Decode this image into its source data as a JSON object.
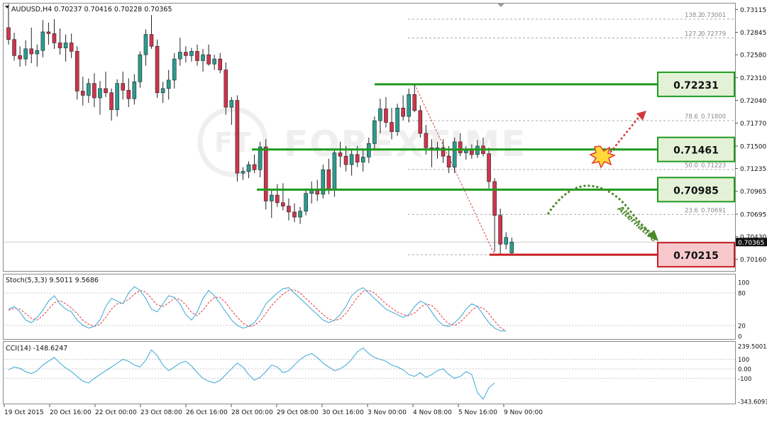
{
  "colors": {
    "bull": "#2a9d8f",
    "bear": "#d0344d",
    "green_level": "#1f9a1f",
    "red_level": "#c81d25",
    "label_green_bg": "#e3f2d6",
    "label_red_bg": "#f7c9cd",
    "stoch_main": "#3aa7d6",
    "stoch_signal": "#e23a3a",
    "cci_line": "#3aa7d6",
    "dotted_green": "#4c8a2a",
    "dotted_red": "#d23a3a"
  },
  "header": {
    "symbol_text": "AUDUSD,H4  0.70237 0.70416 0.70228 0.70365"
  },
  "watermark": "FOREXTIME",
  "chart_data": [
    {
      "type": "candlestick",
      "title": "AUDUSD,H4",
      "ohlc_last": {
        "open": 0.70237,
        "high": 0.70416,
        "low": 0.70228,
        "close": 0.70365
      },
      "ylim": [
        0.7004,
        0.7316
      ],
      "y_ticks": [
        "0.73115",
        "0.72845",
        "0.72580",
        "0.72310",
        "0.72040",
        "0.71770",
        "0.71500",
        "0.71235",
        "0.70965",
        "0.70695",
        "0.70430",
        "0.70160"
      ],
      "current_price": "0.70365",
      "candles": [
        [
          0.729,
          0.7318,
          0.727,
          0.7276
        ],
        [
          0.7276,
          0.7284,
          0.7251,
          0.7257
        ],
        [
          0.7257,
          0.7268,
          0.7244,
          0.7253
        ],
        [
          0.7253,
          0.7275,
          0.7245,
          0.7265
        ],
        [
          0.7265,
          0.729,
          0.7248,
          0.7259
        ],
        [
          0.7259,
          0.727,
          0.7244,
          0.7263
        ],
        [
          0.7263,
          0.7299,
          0.7255,
          0.7285
        ],
        [
          0.7285,
          0.7296,
          0.727,
          0.7283
        ],
        [
          0.7283,
          0.73,
          0.7265,
          0.7272
        ],
        [
          0.7272,
          0.7289,
          0.7258,
          0.7266
        ],
        [
          0.7266,
          0.7282,
          0.725,
          0.7272
        ],
        [
          0.7272,
          0.7283,
          0.7254,
          0.7262
        ],
        [
          0.7262,
          0.7268,
          0.7205,
          0.7215
        ],
        [
          0.7215,
          0.7232,
          0.7198,
          0.721
        ],
        [
          0.721,
          0.723,
          0.7201,
          0.7224
        ],
        [
          0.7224,
          0.7236,
          0.7196,
          0.7207
        ],
        [
          0.7207,
          0.7227,
          0.7187,
          0.7218
        ],
        [
          0.7218,
          0.7238,
          0.7208,
          0.7213
        ],
        [
          0.7213,
          0.7218,
          0.718,
          0.7193
        ],
        [
          0.7193,
          0.7229,
          0.7185,
          0.7224
        ],
        [
          0.7224,
          0.7238,
          0.7205,
          0.7216
        ],
        [
          0.7216,
          0.723,
          0.7196,
          0.7206
        ],
        [
          0.7206,
          0.7235,
          0.7199,
          0.7226
        ],
        [
          0.7226,
          0.7262,
          0.7219,
          0.7258
        ],
        [
          0.7258,
          0.7288,
          0.7245,
          0.7282
        ],
        [
          0.7282,
          0.7305,
          0.7265,
          0.7268
        ],
        [
          0.7268,
          0.7276,
          0.7207,
          0.7213
        ],
        [
          0.7213,
          0.7226,
          0.7201,
          0.7218
        ],
        [
          0.7218,
          0.724,
          0.7205,
          0.7228
        ],
        [
          0.7228,
          0.726,
          0.7218,
          0.7253
        ],
        [
          0.7253,
          0.7278,
          0.7245,
          0.7261
        ],
        [
          0.7261,
          0.7268,
          0.7249,
          0.7257
        ],
        [
          0.7257,
          0.7266,
          0.725,
          0.7262
        ],
        [
          0.7262,
          0.727,
          0.7245,
          0.7251
        ],
        [
          0.7251,
          0.7265,
          0.7238,
          0.7258
        ],
        [
          0.7258,
          0.727,
          0.7245,
          0.7247
        ],
        [
          0.7247,
          0.7258,
          0.724,
          0.7253
        ],
        [
          0.7253,
          0.726,
          0.7236,
          0.724
        ],
        [
          0.724,
          0.7249,
          0.7187,
          0.7196
        ],
        [
          0.7196,
          0.7208,
          0.7175,
          0.7204
        ],
        [
          0.7204,
          0.721,
          0.7108,
          0.7118
        ],
        [
          0.7118,
          0.7125,
          0.711,
          0.712
        ],
        [
          0.712,
          0.7132,
          0.7112,
          0.7128
        ],
        [
          0.7128,
          0.714,
          0.7118,
          0.7122
        ],
        [
          0.7122,
          0.7155,
          0.7113,
          0.7149
        ],
        [
          0.7149,
          0.7158,
          0.7075,
          0.7085
        ],
        [
          0.7085,
          0.7098,
          0.7065,
          0.7092
        ],
        [
          0.7092,
          0.7105,
          0.7078,
          0.7083
        ],
        [
          0.7083,
          0.7106,
          0.7074,
          0.7079
        ],
        [
          0.7079,
          0.7088,
          0.7062,
          0.7072
        ],
        [
          0.7072,
          0.7082,
          0.706,
          0.7066
        ],
        [
          0.7066,
          0.7078,
          0.7058,
          0.7073
        ],
        [
          0.7073,
          0.71,
          0.7068,
          0.7094
        ],
        [
          0.7094,
          0.7108,
          0.7082,
          0.7098
        ],
        [
          0.7098,
          0.711,
          0.7085,
          0.7093
        ],
        [
          0.7093,
          0.7128,
          0.7088,
          0.7122
        ],
        [
          0.7122,
          0.7135,
          0.7093,
          0.7098
        ],
        [
          0.7098,
          0.7147,
          0.709,
          0.7142
        ],
        [
          0.7142,
          0.7155,
          0.7125,
          0.7138
        ],
        [
          0.7138,
          0.715,
          0.712,
          0.7128
        ],
        [
          0.7128,
          0.7145,
          0.7115,
          0.714
        ],
        [
          0.714,
          0.715,
          0.7125,
          0.7131
        ],
        [
          0.7131,
          0.7145,
          0.712,
          0.7137
        ],
        [
          0.7137,
          0.716,
          0.713,
          0.7153
        ],
        [
          0.7153,
          0.7185,
          0.7145,
          0.718
        ],
        [
          0.718,
          0.7206,
          0.7165,
          0.7194
        ],
        [
          0.7194,
          0.7208,
          0.7172,
          0.7178
        ],
        [
          0.7178,
          0.7195,
          0.7158,
          0.7167
        ],
        [
          0.7167,
          0.72,
          0.7162,
          0.7195
        ],
        [
          0.7195,
          0.721,
          0.718,
          0.7185
        ],
        [
          0.7185,
          0.7218,
          0.7178,
          0.7211
        ],
        [
          0.7211,
          0.7223,
          0.719,
          0.7192
        ],
        [
          0.7192,
          0.7198,
          0.716,
          0.7165
        ],
        [
          0.7165,
          0.7175,
          0.714,
          0.7148
        ],
        [
          0.7148,
          0.7158,
          0.7125,
          0.7145
        ],
        [
          0.7145,
          0.7155,
          0.7135,
          0.7148
        ],
        [
          0.7148,
          0.7158,
          0.713,
          0.7138
        ],
        [
          0.7138,
          0.715,
          0.7118,
          0.7125
        ],
        [
          0.7125,
          0.716,
          0.7118,
          0.7155
        ],
        [
          0.7155,
          0.7165,
          0.7138,
          0.7142
        ],
        [
          0.7142,
          0.715,
          0.7134,
          0.7146
        ],
        [
          0.7146,
          0.7152,
          0.7135,
          0.714
        ],
        [
          0.714,
          0.7157,
          0.7136,
          0.715
        ],
        [
          0.715,
          0.716,
          0.7138,
          0.7141
        ],
        [
          0.7141,
          0.7148,
          0.71,
          0.7108
        ],
        [
          0.7108,
          0.7112,
          0.7025,
          0.7068
        ],
        [
          0.7068,
          0.7076,
          0.7022,
          0.7034
        ],
        [
          0.7034,
          0.7048,
          0.7028,
          0.7042
        ],
        [
          0.70237,
          0.70416,
          0.70228,
          0.70365
        ]
      ],
      "levels": [
        {
          "price": 0.7223,
          "label": "0.72231",
          "kind": "green"
        },
        {
          "price": 0.7146,
          "label": "0.71461",
          "kind": "green"
        },
        {
          "price": 0.70985,
          "label": "0.70985",
          "kind": "green"
        },
        {
          "price": 0.70215,
          "label": "0.70215",
          "kind": "red"
        }
      ],
      "fib_levels": [
        {
          "price": 0.73001,
          "label": "138.2",
          "value": "0.73001"
        },
        {
          "price": 0.72779,
          "label": "127.2",
          "value": "0.72779"
        },
        {
          "price": 0.718,
          "label": "78.6",
          "value": "0.71800"
        },
        {
          "price": 0.71223,
          "label": "50.0",
          "value": "0.71223"
        },
        {
          "price": 0.70691,
          "label": "23.6",
          "value": "0.70691"
        },
        {
          "price": 0.70215,
          "label": "",
          "value": ""
        }
      ],
      "annotation": "Alternative"
    },
    {
      "type": "line",
      "title": "Stoch(5,3,3) 9.5011 9.5686",
      "ylim": [
        0,
        100
      ],
      "y_ticks": [
        "100",
        "80",
        "20",
        "0"
      ],
      "series": [
        {
          "name": "main",
          "values": [
            50,
            55,
            45,
            30,
            25,
            35,
            48,
            65,
            75,
            60,
            50,
            45,
            30,
            20,
            15,
            18,
            30,
            55,
            70,
            65,
            60,
            80,
            92,
            85,
            70,
            50,
            45,
            60,
            75,
            72,
            60,
            40,
            30,
            45,
            70,
            85,
            75,
            60,
            45,
            30,
            20,
            15,
            18,
            25,
            40,
            60,
            70,
            80,
            88,
            90,
            80,
            70,
            60,
            50,
            40,
            30,
            25,
            30,
            40,
            55,
            75,
            85,
            90,
            80,
            70,
            60,
            50,
            45,
            40,
            35,
            40,
            55,
            65,
            60,
            45,
            30,
            20,
            18,
            25,
            35,
            50,
            60,
            55,
            40,
            25,
            15,
            10,
            9.5
          ]
        },
        {
          "name": "signal",
          "values": [
            48,
            52,
            50,
            42,
            33,
            30,
            38,
            50,
            62,
            66,
            60,
            52,
            42,
            30,
            22,
            18,
            22,
            35,
            50,
            60,
            62,
            68,
            78,
            85,
            82,
            70,
            58,
            55,
            62,
            70,
            68,
            58,
            44,
            38,
            48,
            62,
            72,
            72,
            62,
            48,
            35,
            24,
            18,
            20,
            28,
            42,
            57,
            68,
            78,
            85,
            86,
            80,
            70,
            60,
            50,
            40,
            32,
            29,
            32,
            42,
            57,
            72,
            83,
            85,
            80,
            70,
            60,
            52,
            45,
            40,
            38,
            43,
            53,
            60,
            57,
            47,
            33,
            23,
            20,
            26,
            37,
            48,
            55,
            52,
            42,
            28,
            16,
            9.6
          ]
        }
      ]
    },
    {
      "type": "line",
      "title": "CCI(14) -148.6247",
      "ylim": [
        -343.6091,
        239.5001
      ],
      "y_ticks": [
        "239.5001",
        "100",
        "0.00",
        "-100",
        "-343.6091"
      ],
      "series": [
        {
          "name": "CCI",
          "values": [
            -10,
            20,
            5,
            -30,
            -50,
            -20,
            40,
            80,
            120,
            60,
            10,
            -30,
            -80,
            -130,
            -150,
            -100,
            -60,
            -20,
            20,
            60,
            100,
            80,
            40,
            20,
            90,
            200,
            140,
            40,
            -20,
            20,
            60,
            80,
            30,
            -40,
            -100,
            -130,
            -150,
            -120,
            -60,
            0,
            60,
            20,
            -60,
            -120,
            -90,
            -30,
            40,
            20,
            -40,
            -20,
            40,
            100,
            140,
            160,
            120,
            60,
            20,
            -20,
            0,
            40,
            100,
            180,
            220,
            160,
            120,
            100,
            80,
            40,
            20,
            -10,
            -60,
            -80,
            -40,
            -90,
            -60,
            -20,
            0,
            -60,
            -100,
            -80,
            -30,
            -60,
            -250,
            -320,
            -200,
            -148.6
          ]
        }
      ]
    }
  ],
  "time_axis": [
    "19 Oct 2015",
    "20 Oct 16:00",
    "22 Oct 00:00",
    "23 Oct 08:00",
    "26 Oct 16:00",
    "28 Oct 00:00",
    "29 Oct 08:00",
    "30 Oct 16:00",
    "3 Nov 00:00",
    "4 Nov 08:00",
    "5 Nov 16:00",
    "9 Nov 00:00"
  ]
}
